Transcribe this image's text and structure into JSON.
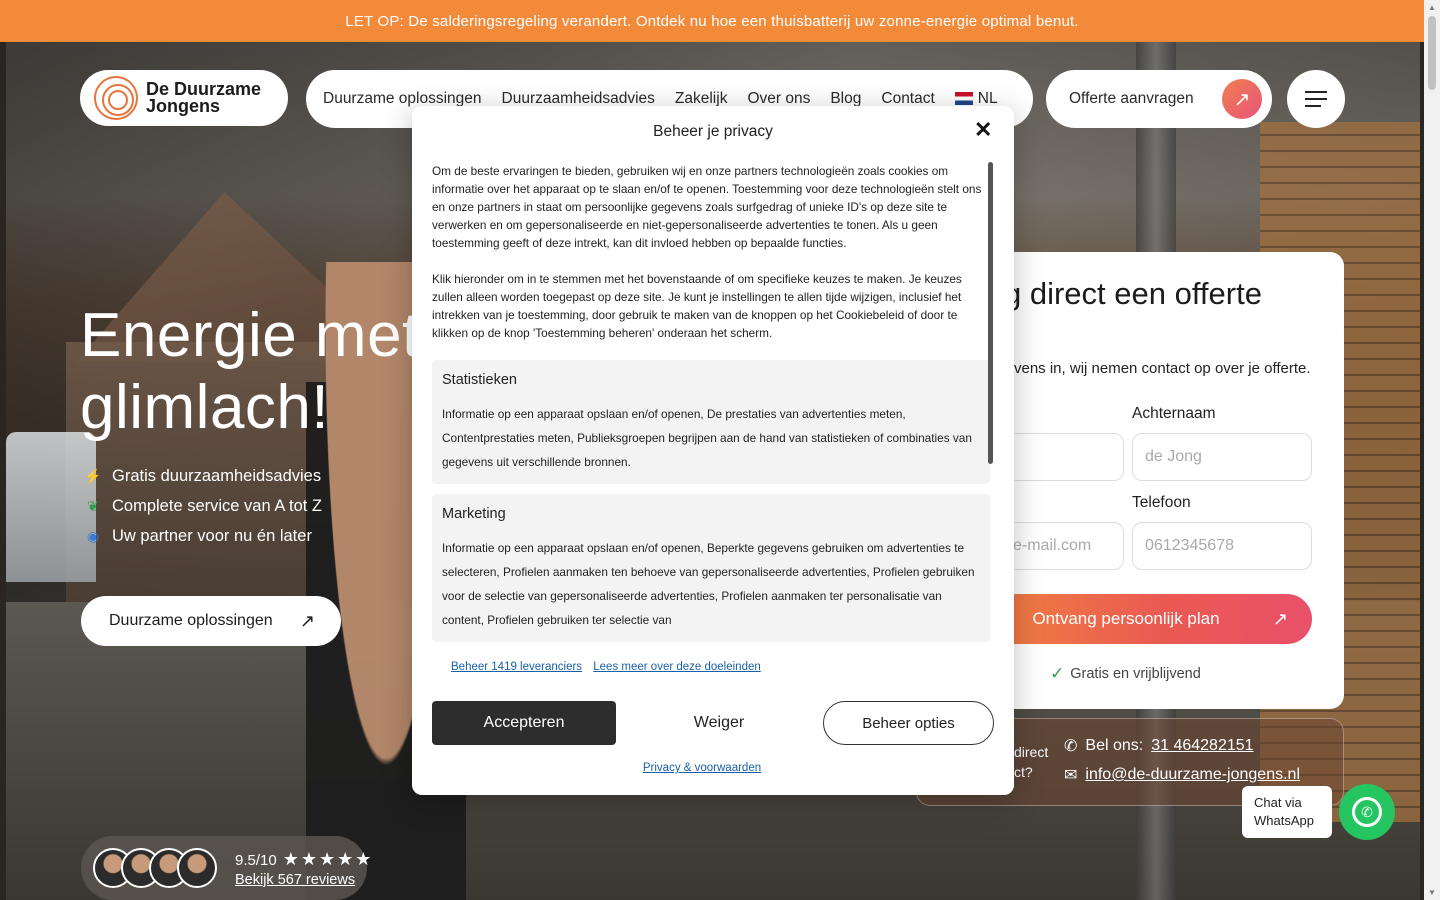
{
  "banner": {
    "text": "LET OP: De salderingsregeling verandert. Ontdek nu hoe een thuisbatterij uw zonne-energie optimal benut."
  },
  "logo": {
    "line1": "De Duurzame",
    "line2": "Jongens"
  },
  "nav": {
    "items": [
      "Duurzame oplossingen",
      "Duurzaamheidsadvies",
      "Zakelijk",
      "Over ons",
      "Blog",
      "Contact"
    ],
    "language": "NL"
  },
  "header": {
    "offer_label": "Offerte aanvragen",
    "offer_icon": "arrow-up-right-icon",
    "menu_icon": "hamburger-icon"
  },
  "hero": {
    "headline_line1": "Energie met",
    "headline_line2": "glimlach!",
    "usps": [
      "Gratis duurzaamheidsadvies",
      "Complete service van A tot Z",
      "Uw partner voor nu én later"
    ],
    "cta_label": "Duurzame oplossingen"
  },
  "reviews": {
    "score": "9.5/10",
    "stars": "★★★★★",
    "link": "Bekijk 567 reviews"
  },
  "form": {
    "title": "g direct een offerte",
    "subtitle": "vens in, wij nemen contact op over je offerte.",
    "firstname_label": "n",
    "lastname_label": "Achternaam",
    "lastname_placeholder": "de Jong",
    "email_placeholder": "e-mail.com",
    "phone_label": "Telefoon",
    "phone_placeholder": "0612345678",
    "submit_label": "Ontvang persoonlijk plan",
    "free_note": "Gratis en vrijblijvend"
  },
  "contact": {
    "question_line1": "direct",
    "question_line2": "ct?",
    "phone_prefix": "Bel ons:",
    "phone": "31 464282151",
    "email": "info@de-duurzame-jongens.nl"
  },
  "whatsapp": {
    "label_line1": "Chat via",
    "label_line2": "WhatsApp"
  },
  "privacy": {
    "title": "Beheer je privacy",
    "paragraph1": "Om de beste ervaringen te bieden, gebruiken wij en onze partners technologieën zoals cookies om informatie over het apparaat op te slaan en/of te openen. Toestemming voor deze technologieën stelt ons en onze partners in staat om persoonlijke gegevens zoals surfgedrag of unieke ID's op deze site te verwerken en om gepersonaliseerde en niet-gepersonaliseerde advertenties te tonen. Als u geen toestemming geeft of deze intrekt, kan dit invloed hebben op bepaalde functies.",
    "paragraph2": "Klik hieronder om in te stemmen met het bovenstaande of om specifieke keuzes te maken. Je keuzes zullen alleen worden toegepast op deze site. Je kunt je instellingen te allen tijde wijzigen, inclusief het intrekken van je toestemming, door gebruik te maken van de knoppen op het Cookiebeleid of door te klikken op de knop 'Toestemming beheren' onderaan het scherm.",
    "categories": [
      {
        "title": "Statistieken",
        "text": "Informatie op een apparaat opslaan en/of openen, De prestaties van advertenties meten, Contentprestaties meten, Publieksgroepen begrijpen aan de hand van statistieken of combinaties van gegevens uit verschillende bronnen."
      },
      {
        "title": "Marketing",
        "text": "Informatie op een apparaat opslaan en/of openen, Beperkte gegevens gebruiken om advertenties te selecteren, Profielen aanmaken ten behoeve van gepersonaliseerde advertenties, Profielen gebruiken voor de selectie van gepersonaliseerde advertenties, Profielen aanmaken ter personalisatie van content, Profielen gebruiken ter selectie van"
      }
    ],
    "link_vendors": "Beheer 1419 leveranciers",
    "link_purposes": "Lees meer over deze doeleinden",
    "accept": "Accepteren",
    "reject": "Weiger",
    "options": "Beheer opties",
    "footer_link": "Privacy & voorwaarden"
  }
}
